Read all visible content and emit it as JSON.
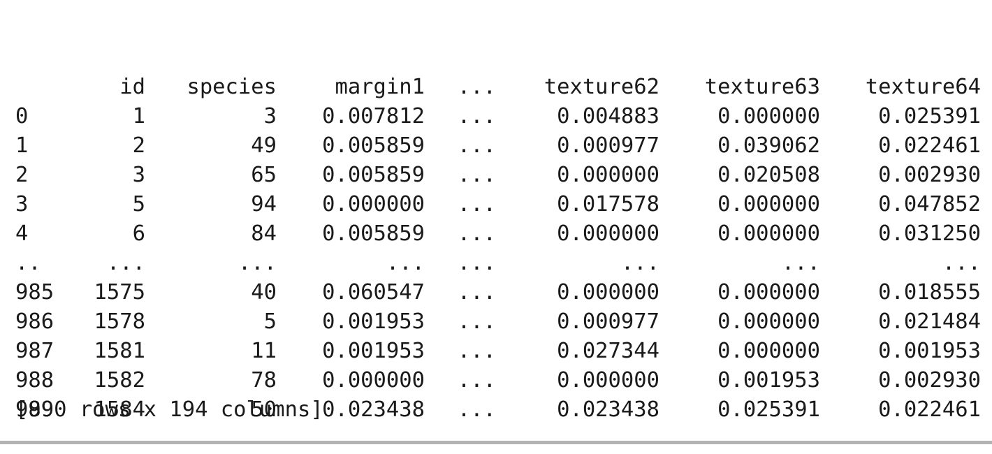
{
  "dataframe": {
    "columns": [
      "",
      "id",
      "species",
      "margin1",
      "...",
      "texture62",
      "texture63",
      "texture64"
    ],
    "rows": [
      [
        "0",
        "1",
        "3",
        "0.007812",
        "...",
        "0.004883",
        "0.000000",
        "0.025391"
      ],
      [
        "1",
        "2",
        "49",
        "0.005859",
        "...",
        "0.000977",
        "0.039062",
        "0.022461"
      ],
      [
        "2",
        "3",
        "65",
        "0.005859",
        "...",
        "0.000000",
        "0.020508",
        "0.002930"
      ],
      [
        "3",
        "5",
        "94",
        "0.000000",
        "...",
        "0.017578",
        "0.000000",
        "0.047852"
      ],
      [
        "4",
        "6",
        "84",
        "0.005859",
        "...",
        "0.000000",
        "0.000000",
        "0.031250"
      ],
      [
        "..",
        "...",
        "...",
        "...",
        "...",
        "...",
        "...",
        "..."
      ],
      [
        "985",
        "1575",
        "40",
        "0.060547",
        "...",
        "0.000000",
        "0.000000",
        "0.018555"
      ],
      [
        "986",
        "1578",
        "5",
        "0.001953",
        "...",
        "0.000977",
        "0.000000",
        "0.021484"
      ],
      [
        "987",
        "1581",
        "11",
        "0.001953",
        "...",
        "0.027344",
        "0.000000",
        "0.001953"
      ],
      [
        "988",
        "1582",
        "78",
        "0.000000",
        "...",
        "0.000000",
        "0.001953",
        "0.002930"
      ],
      [
        "989",
        "1584",
        "50",
        "0.023438",
        "...",
        "0.023438",
        "0.025391",
        "0.022461"
      ]
    ],
    "summary": "[990 rows x 194 columns]"
  }
}
